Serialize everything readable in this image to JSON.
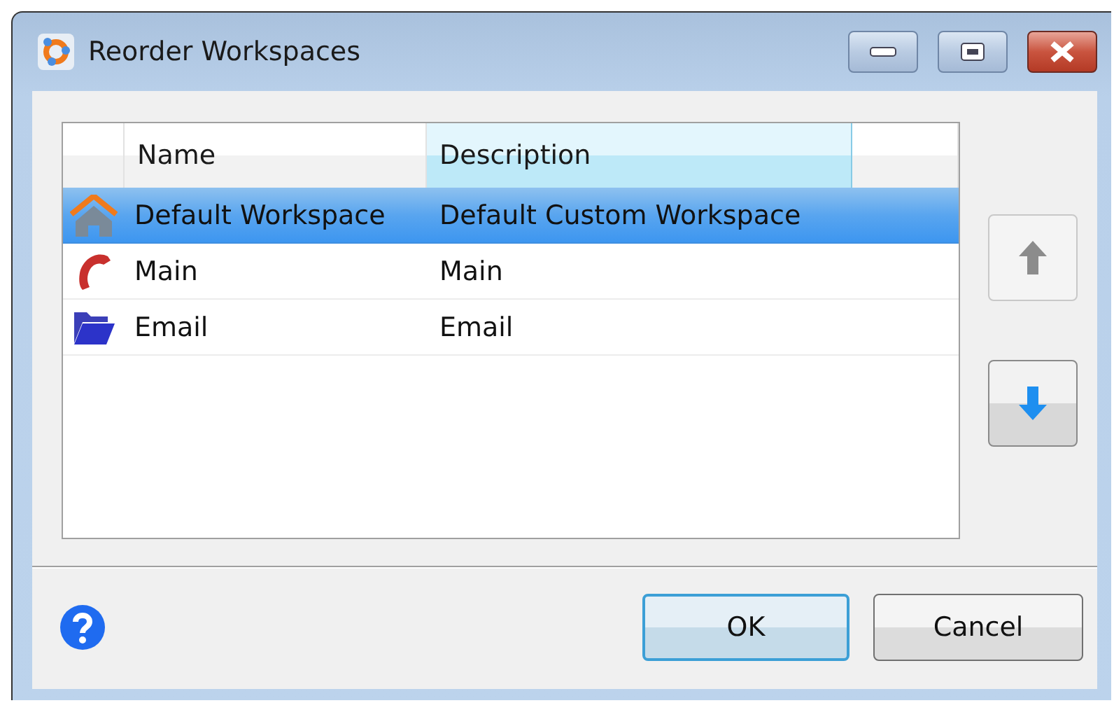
{
  "window": {
    "title": "Reorder Workspaces"
  },
  "table": {
    "columns": [
      {
        "label": "Name",
        "selected": false
      },
      {
        "label": "Description",
        "selected": true
      }
    ],
    "rows": [
      {
        "kind": "home",
        "name": "Default Workspace",
        "description": "Default Custom Workspace",
        "selected": true
      },
      {
        "kind": "phone",
        "name": "Main",
        "description": "Main",
        "selected": false
      },
      {
        "kind": "folder",
        "name": "Email",
        "description": "Email",
        "selected": false
      }
    ]
  },
  "move_buttons": [
    {
      "kind": "up",
      "disabled": true
    },
    {
      "kind": "down",
      "disabled": false
    }
  ],
  "buttons": [
    {
      "label": "OK",
      "default": true
    },
    {
      "label": "Cancel",
      "default": false
    }
  ]
}
